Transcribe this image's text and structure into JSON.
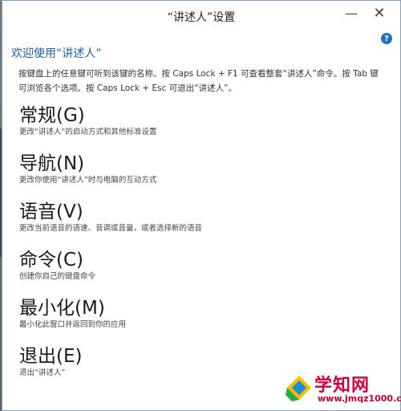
{
  "window": {
    "title": "“讲述人”设置",
    "minimize_glyph": "—",
    "close_glyph": "✕",
    "help_glyph": "?"
  },
  "welcome": "欢迎使用“讲述人”",
  "intro": "按键盘上的任意键可听到该键的名称。按 Caps Lock + F1 可查看整套“讲述人”命令。按 Tab 键可浏览各个选项。按 Caps Lock + Esc 可退出“讲述人”。",
  "menu": [
    {
      "title": "常规(G)",
      "desc": "更改“讲述人”的启动方式和其他标准设置"
    },
    {
      "title": "导航(N)",
      "desc": "更改你使用“讲述人”时与电脑的互动方式"
    },
    {
      "title": "语音(V)",
      "desc": "更改当前语音的语速、音调或音量，或者选择新的语音"
    },
    {
      "title": "命令(C)",
      "desc": "创建你自己的键盘命令"
    },
    {
      "title": "最小化(M)",
      "desc": "最小化此窗口并返回到你的应用"
    },
    {
      "title": "退出(E)",
      "desc": "退出“讲述人”"
    }
  ],
  "watermark": {
    "title": "学知网",
    "url": "www.jmqz1000.com"
  },
  "colors": {
    "accent": "#1f5ea8",
    "help": "#1f6fbf",
    "watermark": "#d4003b"
  }
}
